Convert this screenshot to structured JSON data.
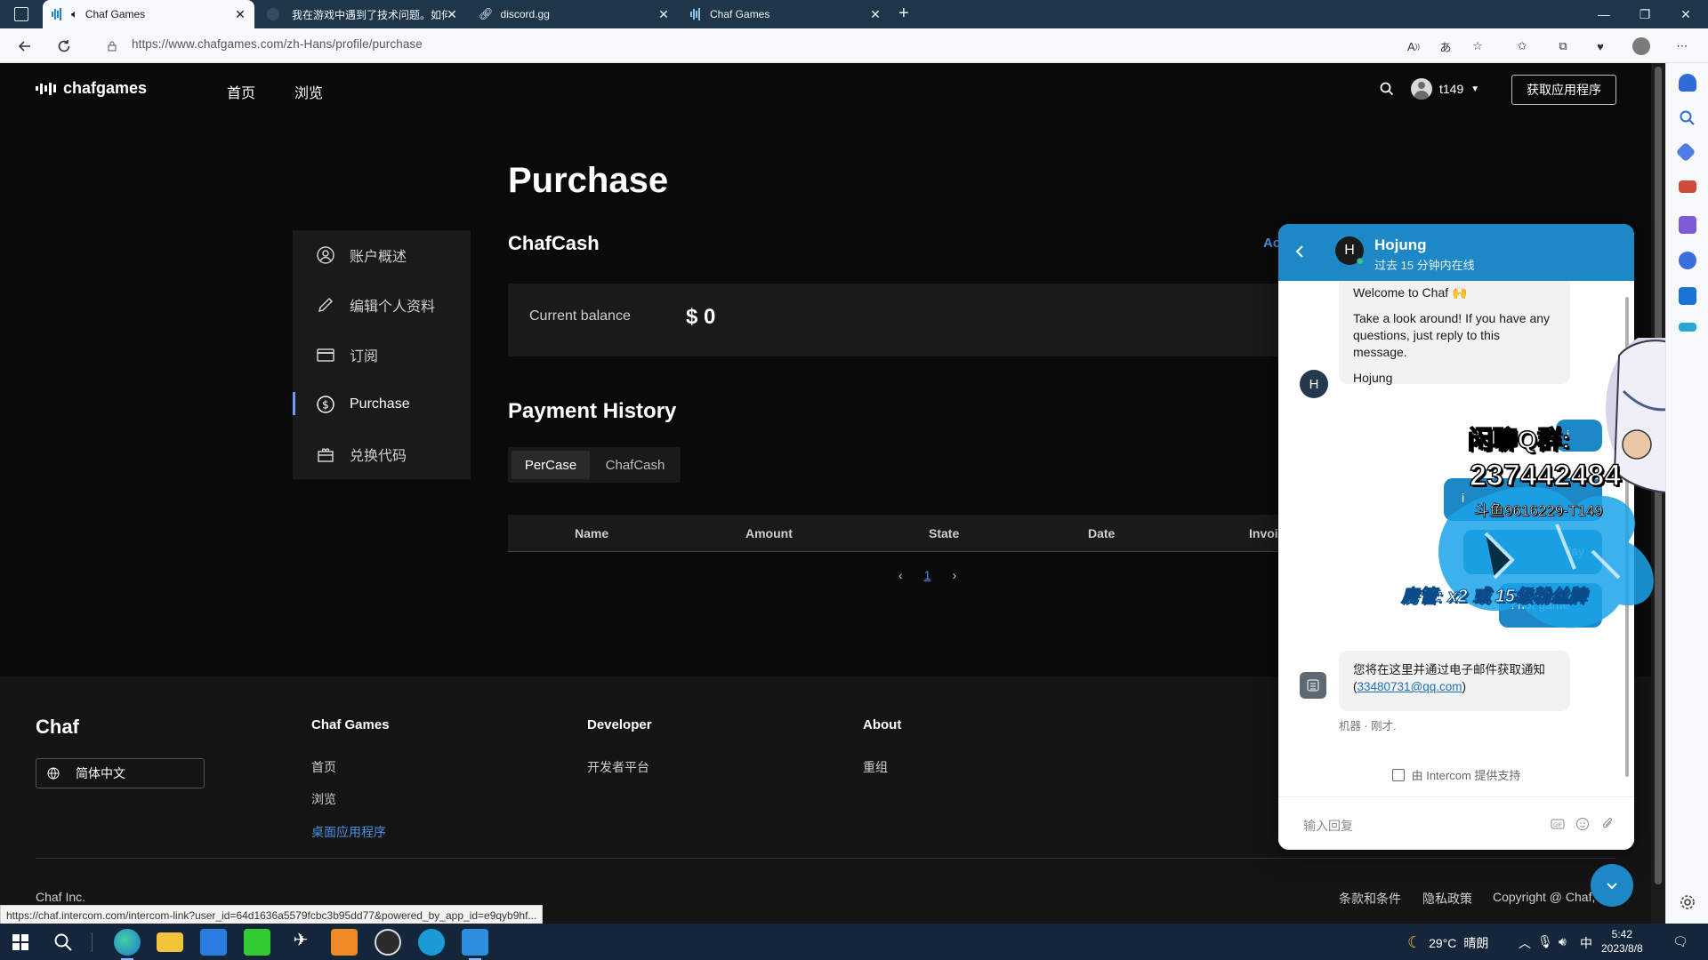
{
  "browser": {
    "tabs": [
      {
        "title": "Chaf Games",
        "active": true
      },
      {
        "title": "我在游戏中遇到了技术问题。如何",
        "active": false
      },
      {
        "title": "discord.gg",
        "active": false
      },
      {
        "title": "Chaf Games",
        "active": false
      }
    ],
    "url": "https://www.chafgames.com/zh-Hans/profile/purchase",
    "status_url": "https://chaf.intercom.com/intercom-link?user_id=64d1636a5579fcbc3b95dd77&powered_by_app_id=e9qyb9hf..."
  },
  "site": {
    "logo": "chafgames",
    "nav": [
      "首页",
      "浏览"
    ],
    "username": "t149",
    "get_app": "获取应用程序",
    "page_title": "Purchase",
    "side_menu": [
      {
        "label": "账户概述",
        "icon": "user-circle-icon"
      },
      {
        "label": "编辑个人资料",
        "icon": "pencil-icon"
      },
      {
        "label": "订阅",
        "icon": "card-icon"
      },
      {
        "label": "Purchase",
        "icon": "dollar-circle-icon",
        "active": true
      },
      {
        "label": "兑换代码",
        "icon": "gift-icon"
      }
    ],
    "chafcash": {
      "heading": "ChafCash",
      "action": "Ac",
      "balance_label": "Current balance",
      "balance_value": "$ 0"
    },
    "payment_history": {
      "heading": "Payment History",
      "tabs": [
        "PerCase",
        "ChafCash"
      ],
      "columns": [
        "Name",
        "Amount",
        "State",
        "Date",
        "Invoi"
      ],
      "page": "1"
    },
    "footer": {
      "brand": "Chaf",
      "language": "简体中文",
      "cols": [
        {
          "title": "Chaf Games",
          "links": [
            "首页",
            "浏览",
            "桌面应用程序"
          ]
        },
        {
          "title": "Developer",
          "links": [
            "开发者平台"
          ]
        },
        {
          "title": "About",
          "links": [
            "重组"
          ]
        }
      ],
      "bottom_left": "Chaf Inc.",
      "bottom_links": [
        "条款和条件",
        "隐私政策",
        "Copyright @ Chaf, Inc."
      ]
    }
  },
  "messenger": {
    "agent_name": "Hojung",
    "agent_initial": "H",
    "status": "过去 15 分钟内在线",
    "welcome_line": "Welcome to Chaf 🙌",
    "welcome_body": "Take a look around! If you have any questions, just reply to this message.",
    "welcome_sign": "Hojung",
    "user_msgs": [
      "i",
      "i",
      "lay",
      "i not game"
    ],
    "bot_msg": "您将在这里并通过电子邮件获取通知 (",
    "bot_email": "33480731@qq.com",
    "bot_msg_end": ")",
    "bot_meta": "机器 · 刚才.",
    "powered_by": "由 Intercom 提供支持",
    "input_placeholder": "输入回复"
  },
  "overlay": {
    "q_group": "闲聊Q群:",
    "q_number": "237442484",
    "douyu": "斗鱼9616229-T149",
    "fan_badge": "房管: x2 或 15级粉丝牌"
  },
  "taskbar": {
    "temperature": "29°C",
    "weather": "晴朗",
    "ime": "中",
    "time": "5:42",
    "date": "2023/8/8"
  }
}
